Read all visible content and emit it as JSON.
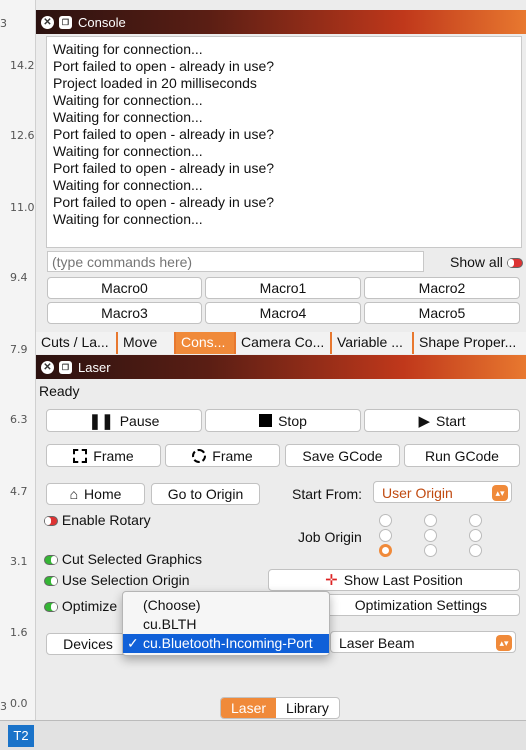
{
  "ruler": [
    "3",
    "14.2",
    "12.6",
    "11.0",
    "9.4",
    "7.9",
    "6.3",
    "4.7",
    "3.1",
    "1.6",
    "0.0",
    "3"
  ],
  "console": {
    "title": "Console",
    "lines": [
      "Waiting for connection...",
      "Port failed to open - already in use?",
      "Project loaded in 20 milliseconds",
      "Waiting for connection...",
      "Waiting for connection...",
      "Port failed to open - already in use?",
      "Waiting for connection...",
      "Port failed to open - already in use?",
      "Waiting for connection...",
      "Port failed to open - already in use?",
      "Waiting for connection..."
    ],
    "command_placeholder": "(type commands here)",
    "show_all_label": "Show all",
    "macros": [
      "Macro0",
      "Macro1",
      "Macro2",
      "Macro3",
      "Macro4",
      "Macro5"
    ]
  },
  "tabs": [
    "Cuts / La...",
    "Move",
    "Cons...",
    "Camera Co...",
    "Variable ...",
    "Shape Proper..."
  ],
  "active_tab": "Cons...",
  "laser": {
    "title": "Laser",
    "status": "Ready",
    "pause": "Pause",
    "stop": "Stop",
    "start": "Start",
    "frame1": "Frame",
    "frame2": "Frame",
    "save_gcode": "Save GCode",
    "run_gcode": "Run GCode",
    "home": "Home",
    "go_to_origin": "Go to Origin",
    "start_from_label": "Start From:",
    "start_from_value": "User Origin",
    "enable_rotary": "Enable Rotary",
    "job_origin_label": "Job Origin",
    "cut_selected": "Cut Selected Graphics",
    "use_selection_origin": "Use Selection Origin",
    "show_last_position": "Show Last Position",
    "optimize": "Optimize",
    "optimization_settings": "Optimization Settings",
    "devices": "Devices",
    "laser_beam": "Laser Beam",
    "port_options": [
      "(Choose)",
      "cu.BLTH",
      "cu.Bluetooth-Incoming-Port"
    ],
    "selected_port": "cu.Bluetooth-Incoming-Port"
  },
  "bottom_tabs": [
    "Laser",
    "Library"
  ],
  "taskbar": {
    "t2": "T2"
  },
  "colors": {
    "accent": "#f08a3a",
    "selection": "#1060d8"
  }
}
